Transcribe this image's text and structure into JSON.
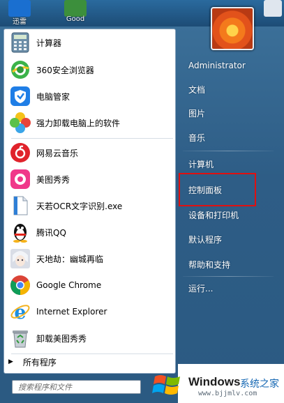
{
  "desktop": {
    "icons": [
      {
        "label": "迅雷",
        "color": "#1a6fd0"
      },
      {
        "label": "Good",
        "color": "#3c8f3c"
      }
    ]
  },
  "left_pane": {
    "pinned": [
      {
        "label": "计算器",
        "icon": "calculator-icon"
      },
      {
        "label": "360安全浏览器",
        "icon": "360-browser-icon"
      },
      {
        "label": "电脑管家",
        "icon": "pc-manager-shield-icon"
      },
      {
        "label": "强力卸载电脑上的软件",
        "icon": "uninstall-pinwheel-icon"
      }
    ],
    "recent": [
      {
        "label": "网易云音乐",
        "icon": "netease-music-icon"
      },
      {
        "label": "美图秀秀",
        "icon": "meitu-icon"
      },
      {
        "label": "天若OCR文字识别.exe",
        "icon": "ocr-file-icon"
      },
      {
        "label": "腾讯QQ",
        "icon": "qq-penguin-icon"
      },
      {
        "label": "天地劫：幽城再临",
        "icon": "game-avatar-icon"
      },
      {
        "label": "Google Chrome",
        "icon": "chrome-icon"
      },
      {
        "label": "Internet Explorer",
        "icon": "internet-explorer-icon"
      },
      {
        "label": "卸载美图秀秀",
        "icon": "recycle-bin-icon"
      }
    ],
    "all_programs": "所有程序",
    "search_placeholder": "搜索程序和文件"
  },
  "right_pane": {
    "user_name": "Administrator",
    "items": [
      {
        "label": "文档"
      },
      {
        "label": "图片"
      },
      {
        "label": "音乐"
      },
      {
        "label": "计算机"
      },
      {
        "label": "控制面板"
      },
      {
        "label": "设备和打印机"
      },
      {
        "label": "默认程序"
      },
      {
        "label": "帮助和支持"
      },
      {
        "label": "运行..."
      }
    ]
  },
  "watermark": {
    "brand": "Windows",
    "brand_cn": "系统之家",
    "url": "www.bjjmlv.com"
  },
  "colors": {
    "highlight": "#e01010",
    "menu_blue": "#2e5d86"
  }
}
